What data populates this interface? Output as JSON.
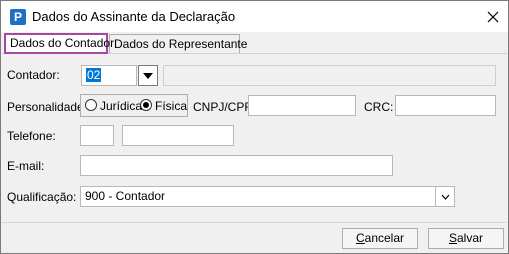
{
  "window": {
    "title": "Dados do Assinante da Declaração",
    "icon": "app-p-icon"
  },
  "tabs": [
    {
      "label": "Dados do Contador",
      "active": true
    },
    {
      "label": "Dados do Representante",
      "active": false
    }
  ],
  "form": {
    "contador": {
      "label": "Contador:",
      "code": "02",
      "name": ""
    },
    "personalidade": {
      "label": "Personalidade:",
      "options": [
        "Jurídica",
        "Física"
      ],
      "selected": "Física"
    },
    "cnpj_cpf": {
      "label": "CNPJ/CPF:",
      "value": ""
    },
    "crc": {
      "label": "CRC:",
      "value": ""
    },
    "telefone": {
      "label": "Telefone:",
      "ddd": "",
      "numero": ""
    },
    "email": {
      "label": "E-mail:",
      "value": ""
    },
    "qualificacao": {
      "label": "Qualificação:",
      "value": "900 - Contador"
    }
  },
  "buttons": {
    "cancel": {
      "first": "C",
      "rest": "ancelar"
    },
    "save": {
      "first": "S",
      "rest": "alvar"
    }
  },
  "colors": {
    "tab_highlight": "#a349a4",
    "selection": "#0078d7",
    "icon": "#1f6fc5"
  }
}
